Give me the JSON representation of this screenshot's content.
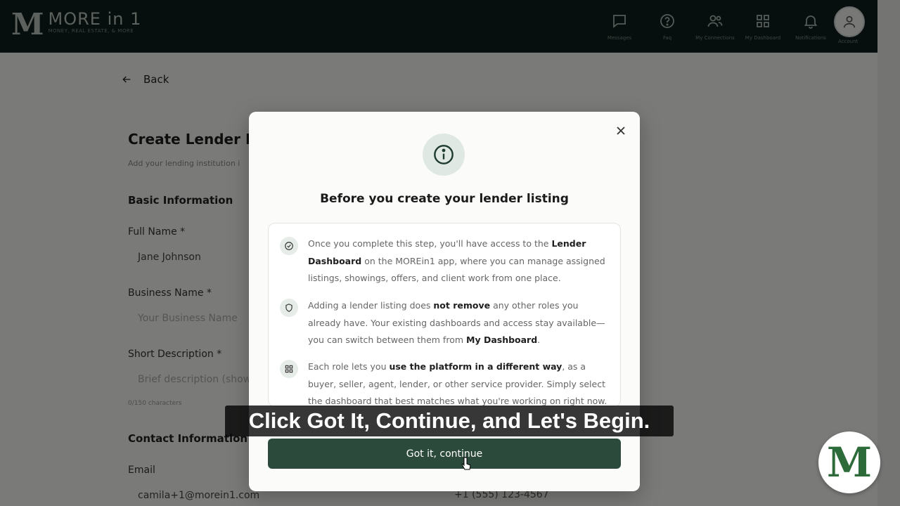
{
  "header": {
    "logo_mark": "M",
    "logo_title": "MORE in 1",
    "logo_subtitle": "MONEY, REAL ESTATE, & MORE",
    "nav": [
      {
        "label": "Messages",
        "icon": "message-icon"
      },
      {
        "label": "Faq",
        "icon": "help-icon"
      },
      {
        "label": "My Connections",
        "icon": "people-icon"
      },
      {
        "label": "My Dashboard",
        "icon": "dashboard-icon"
      },
      {
        "label": "Notifications",
        "icon": "bell-icon"
      }
    ],
    "account_label": "Account"
  },
  "page": {
    "back_label": "Back",
    "title": "Create Lender Pro",
    "subtitle": "Add your lending institution i",
    "basic_info": "Basic Information",
    "full_name_label": "Full Name *",
    "full_name_value": "Jane Johnson",
    "business_name_label": "Business Name *",
    "business_name_placeholder": "Your Business Name",
    "short_desc_label": "Short Description *",
    "short_desc_placeholder": "Brief description (show",
    "char_count": "0/150 characters",
    "contact_info": "Contact Information",
    "email_label": "Email",
    "email_value": "camila+1@morein1.com",
    "phone_value": "+1 (555) 123-4567"
  },
  "modal": {
    "title": "Before you create your lender listing",
    "items": [
      {
        "icon": "check-circle-icon",
        "t1": "Once you complete this step, you'll have access to the ",
        "b1": "Lender Dashboard",
        "t2": " on the MOREin1 app, where you can manage assigned listings, showings, offers, and client work from one place.",
        "b2": "",
        "t3": ""
      },
      {
        "icon": "shield-icon",
        "t1": "Adding a lender listing does ",
        "b1": "not remove",
        "t2": " any other roles you already have. Your existing dashboards and access stay available—you can switch between them from ",
        "b2": "My Dashboard",
        "t3": "."
      },
      {
        "icon": "grid-icon",
        "t1": "Each role lets you ",
        "b1": "use the platform in a different way",
        "t2": ", as a buyer, seller, agent, lender, or other service provider. Simply select the dashboard that best matches what you're working on right now.",
        "b2": "",
        "t3": ""
      }
    ],
    "continue_label": "Got it, continue"
  },
  "caption": "Click Got It, Continue, and Let's Begin.",
  "watermark": "M"
}
